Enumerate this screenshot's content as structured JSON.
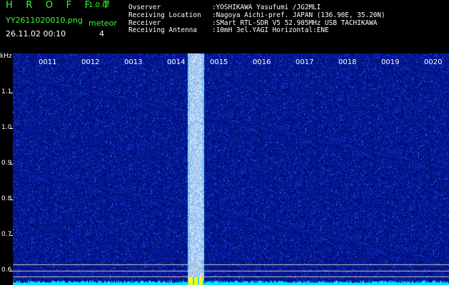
{
  "header": {
    "title": "H R O F F T",
    "version": "1.0.0f",
    "filename": "YY2611020010.png",
    "datetime": "26.11.02 00:10",
    "meteor_label": "meteor",
    "meteor_count": "4"
  },
  "info": {
    "observer_key": "Ovserver",
    "observer_val": ":YOSHIKAWA Yasufumi /JG2MLI",
    "location_key": "Receiving Location",
    "location_val": ":Nagoya Aichi-pref. JAPAN (136.90E, 35.20N)",
    "receiver_key": "Receiver",
    "receiver_val": ":SMart RTL-SDR V5 52.905MHz USB TACHIKAWA",
    "antenna_key": "Receiving Antenna",
    "antenna_val": ":10mH 3el.YAGI Horizontal:ENE"
  },
  "axis": {
    "y_unit": "kHz",
    "y_labels": [
      "1.1",
      "1.0",
      "0.9",
      "0.8",
      "0.7",
      "0.6"
    ],
    "x_labels": [
      "0011",
      "0012",
      "0013",
      "0014",
      "0015",
      "0016",
      "0017",
      "0018",
      "0019",
      "0020"
    ]
  },
  "colors": {
    "background": "#000000",
    "header_green": "#33ff33",
    "noise_low": "#00008c",
    "noise_high": "#2a3cff",
    "burst": "#9fd7ff",
    "baseline": "#00e5ff",
    "marker": "#ffff00"
  }
}
